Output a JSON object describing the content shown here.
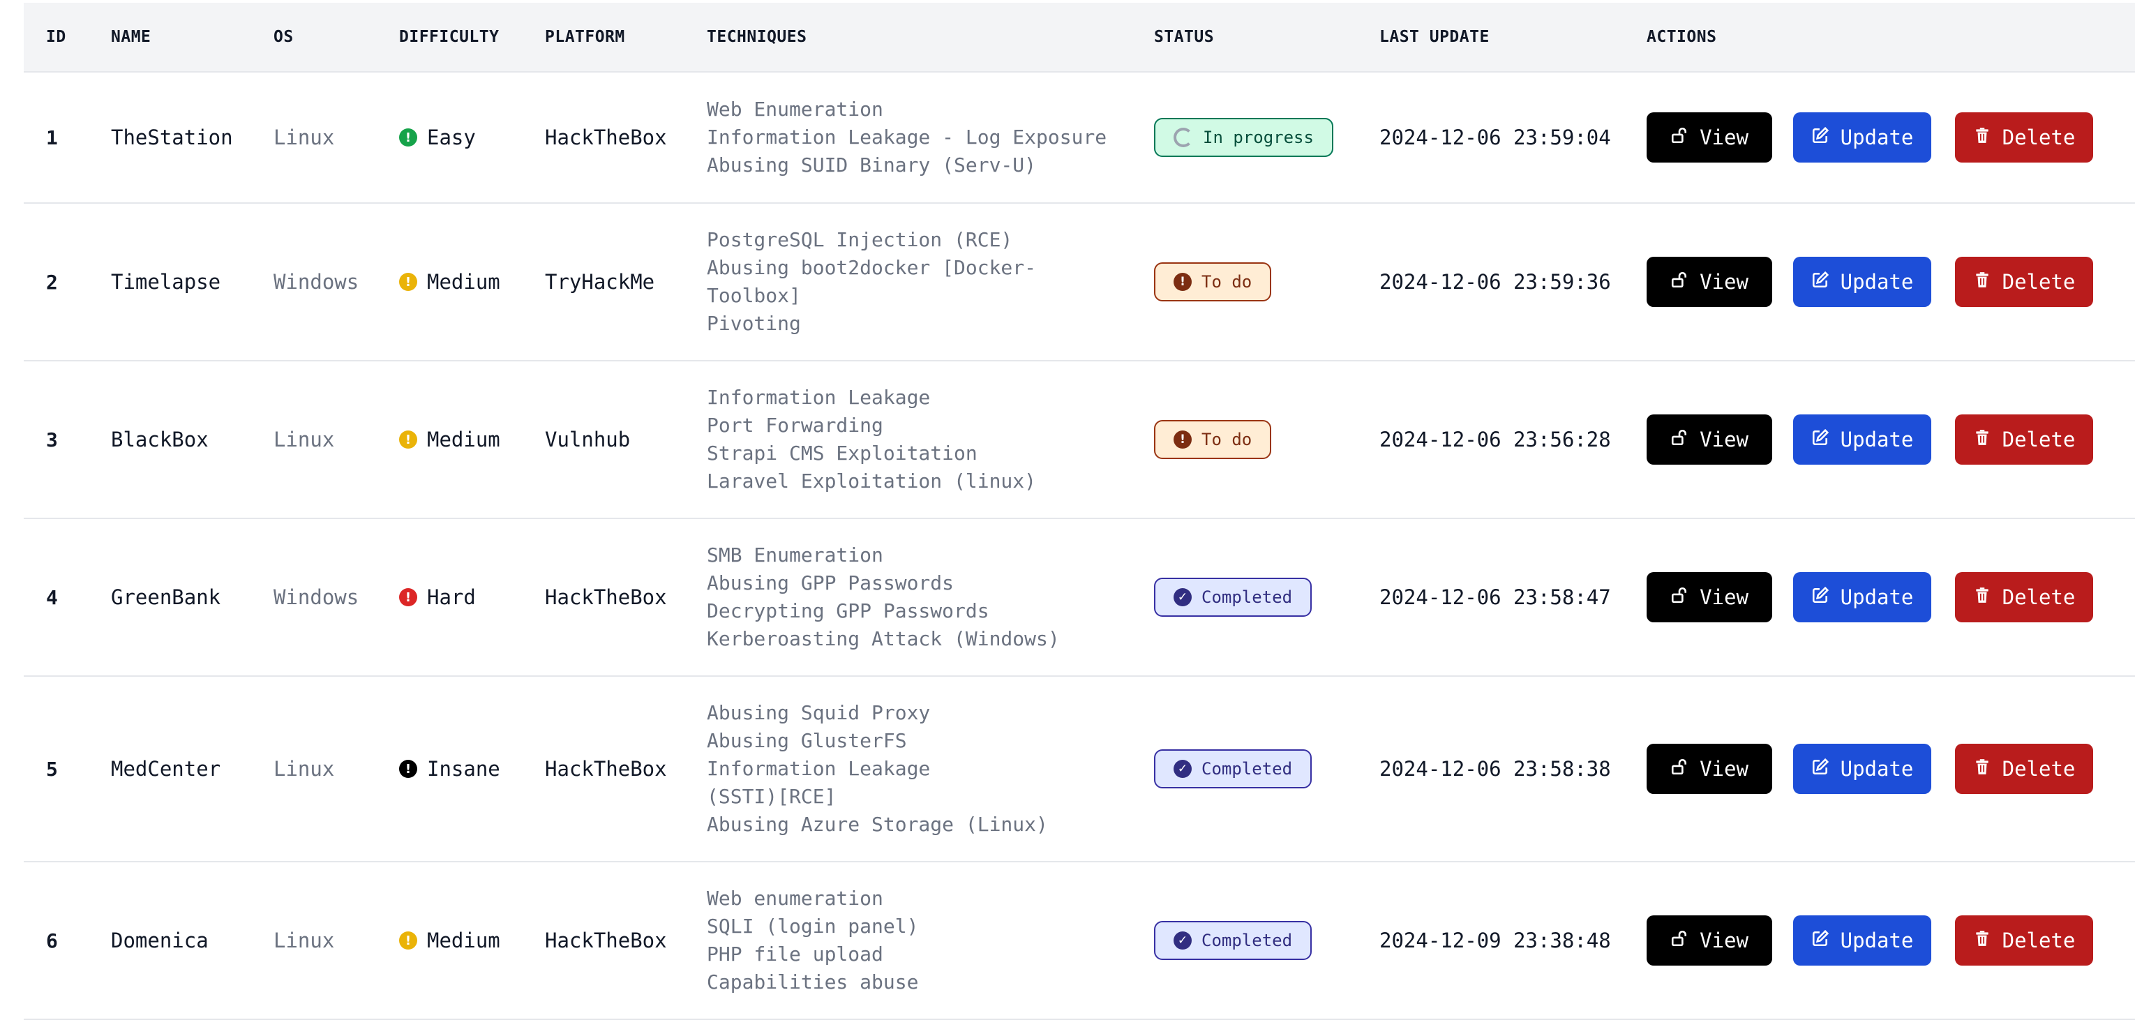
{
  "table": {
    "headers": {
      "id": "ID",
      "name": "NAME",
      "os": "OS",
      "difficulty": "DIFFICULTY",
      "platform": "PLATFORM",
      "techniques": "TECHNIQUES",
      "status": "STATUS",
      "last_update": "LAST UPDATE",
      "actions": "ACTIONS"
    },
    "buttons": {
      "view": "View",
      "update": "Update",
      "delete": "Delete"
    },
    "colors": {
      "easy": "#16a34a",
      "medium": "#eab308",
      "hard": "#dc2626",
      "insane": "#000000",
      "view": "#000000",
      "update": "#1d4ed8",
      "delete": "#b91c1c"
    },
    "rows": [
      {
        "id": "1",
        "name": "TheStation",
        "os": "Linux",
        "difficulty": "Easy",
        "difficulty_level": "easy",
        "difficulty_icon": "!",
        "platform": "HackTheBox",
        "techniques": [
          "Web Enumeration",
          "Information Leakage - Log Exposure",
          "Abusing SUID Binary (Serv-U)"
        ],
        "status": "In progress",
        "status_kind": "progress",
        "status_icon": "spinner-icon",
        "last_update": "2024-12-06 23:59:04"
      },
      {
        "id": "2",
        "name": "Timelapse",
        "os": "Windows",
        "difficulty": "Medium",
        "difficulty_level": "medium",
        "difficulty_icon": "!",
        "platform": "TryHackMe",
        "techniques": [
          "PostgreSQL Injection (RCE)",
          "Abusing boot2docker [Docker-",
          "Toolbox]",
          "Pivoting"
        ],
        "status": "To do",
        "status_kind": "todo",
        "status_icon": "exclamation-icon",
        "last_update": "2024-12-06 23:59:36"
      },
      {
        "id": "3",
        "name": "BlackBox",
        "os": "Linux",
        "difficulty": "Medium",
        "difficulty_level": "medium",
        "difficulty_icon": "!",
        "platform": "Vulnhub",
        "techniques": [
          "Information Leakage",
          "Port Forwarding",
          "Strapi CMS Exploitation",
          "Laravel Exploitation (linux)"
        ],
        "status": "To do",
        "status_kind": "todo",
        "status_icon": "exclamation-icon",
        "last_update": "2024-12-06 23:56:28"
      },
      {
        "id": "4",
        "name": "GreenBank",
        "os": "Windows",
        "difficulty": "Hard",
        "difficulty_level": "hard",
        "difficulty_icon": "!",
        "platform": "HackTheBox",
        "techniques": [
          "SMB Enumeration",
          "Abusing GPP Passwords",
          "Decrypting GPP Passwords",
          "Kerberoasting Attack (Windows)"
        ],
        "status": "Completed",
        "status_kind": "done",
        "status_icon": "check-circle-icon",
        "last_update": "2024-12-06 23:58:47"
      },
      {
        "id": "5",
        "name": "MedCenter",
        "os": "Linux",
        "difficulty": "Insane",
        "difficulty_level": "insane",
        "difficulty_icon": "!",
        "platform": "HackTheBox",
        "techniques": [
          "Abusing Squid Proxy",
          "Abusing GlusterFS",
          "Information Leakage",
          "(SSTI)[RCE]",
          "Abusing Azure Storage (Linux)"
        ],
        "status": "Completed",
        "status_kind": "done",
        "status_icon": "check-circle-icon",
        "last_update": "2024-12-06 23:58:38"
      },
      {
        "id": "6",
        "name": "Domenica",
        "os": "Linux",
        "difficulty": "Medium",
        "difficulty_level": "medium",
        "difficulty_icon": "!",
        "platform": "HackTheBox",
        "techniques": [
          "Web enumeration",
          "SQLI (login panel)",
          "PHP file upload",
          "Capabilities abuse"
        ],
        "status": "Completed",
        "status_kind": "done",
        "status_icon": "check-circle-icon",
        "last_update": "2024-12-09 23:38:48"
      }
    ]
  }
}
